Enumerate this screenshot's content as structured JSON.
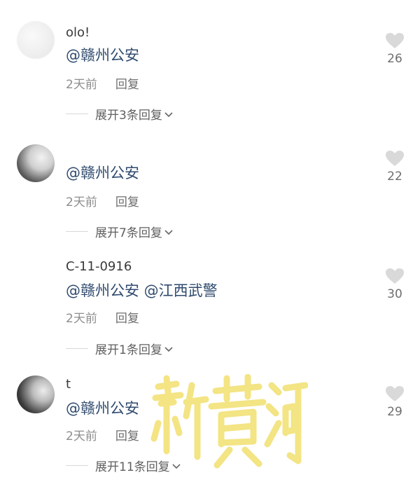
{
  "comments": [
    {
      "username": "olo!",
      "text": "@赣州公安",
      "time": "2天前",
      "reply_label": "回复",
      "expand_label": "展开3条回复",
      "likes": "26"
    },
    {
      "username": "",
      "text": "@赣州公安",
      "time": "2天前",
      "reply_label": "回复",
      "expand_label": "展开7条回复",
      "likes": "22"
    },
    {
      "username": "C-11-0916",
      "text": "@赣州公安 @江西武警",
      "time": "2天前",
      "reply_label": "回复",
      "expand_label": "展开1条回复",
      "likes": "30"
    },
    {
      "username": "t",
      "text": "@赣州公安",
      "time": "2天前",
      "reply_label": "回复",
      "expand_label": "展开11条回复",
      "likes": "29"
    }
  ],
  "watermark": {
    "text": "新黄河",
    "color": "#f3e27a"
  },
  "icons": {
    "like": "heart-icon",
    "expand": "chevron-down-icon"
  },
  "colors": {
    "mention": "#2f4a6e",
    "meta": "#8e8e8e",
    "heart": "#d9d9d9"
  }
}
